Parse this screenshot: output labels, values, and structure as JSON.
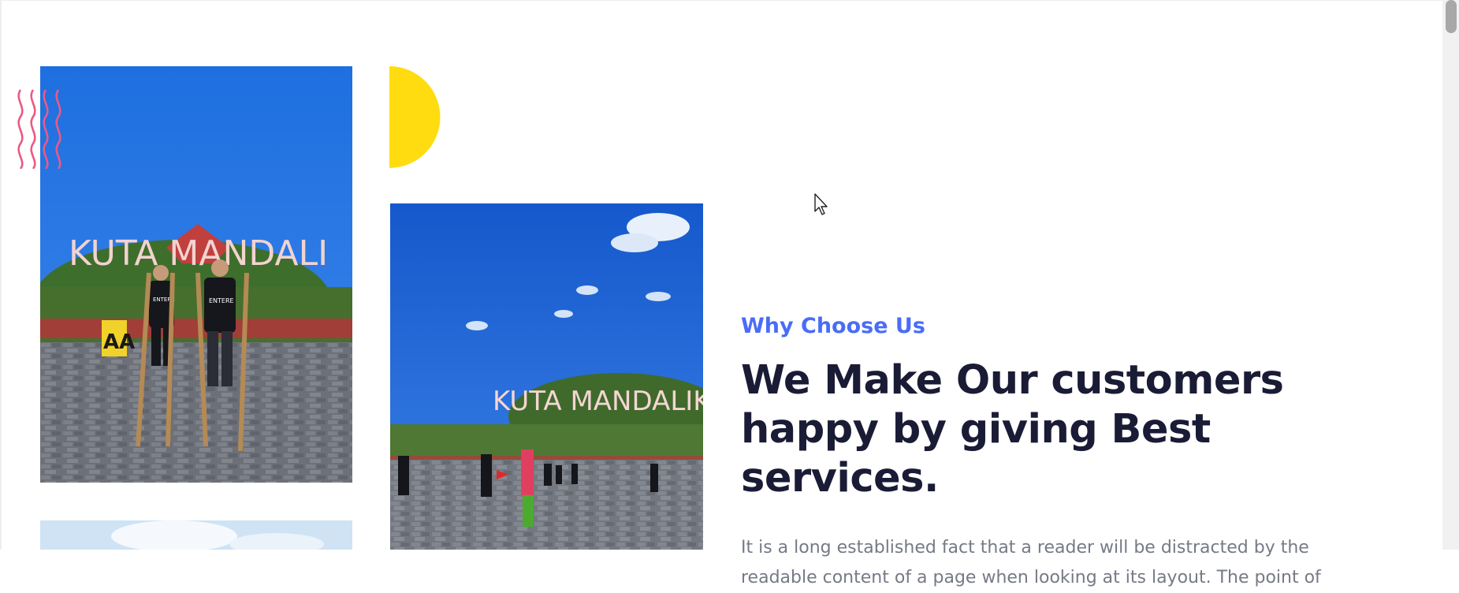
{
  "section": {
    "eyebrow": "Why Choose Us",
    "headline": "We Make Our customers happy by giving Best services.",
    "body": "It is a long established fact that a reader will be distracted by the readable content of a page when looking at its layout. The point of"
  },
  "photos": {
    "left_sign": "KUTA MANDALI",
    "right_sign": "KUTA MANDALIK",
    "shirt_text": "ENTERE",
    "board_text": "AA"
  },
  "colors": {
    "accent": "#4a6cf7",
    "headline": "#1a1b35",
    "body_text": "#757a85",
    "decor_yellow": "#ffdc0f",
    "decor_pink": "#ea5a84"
  },
  "icons": {
    "cursor": "mouse-pointer-icon",
    "wave": "wave-lines-decoration",
    "semicircle": "yellow-semicircle-decoration"
  }
}
